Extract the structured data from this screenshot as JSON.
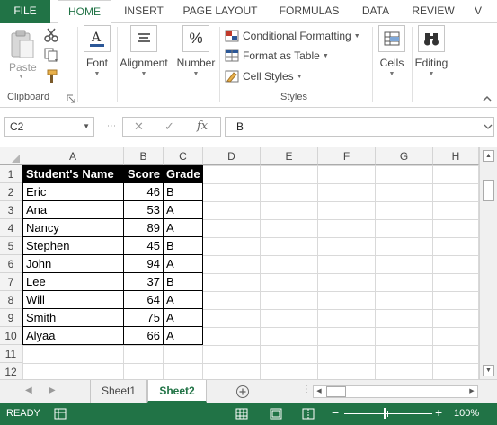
{
  "ribbon_tabs": {
    "file": "FILE",
    "home": "HOME",
    "insert": "INSERT",
    "page_layout": "PAGE LAYOUT",
    "formulas": "FORMULAS",
    "data": "DATA",
    "review": "REVIEW",
    "more": "V"
  },
  "clipboard": {
    "paste_label": "Paste",
    "group_label": "Clipboard"
  },
  "font": {
    "label": "Font",
    "icon": "font-color-icon"
  },
  "alignment": {
    "label": "Alignment",
    "icon": "align-icon"
  },
  "number": {
    "label": "Number",
    "icon": "percent-icon",
    "glyph": "%"
  },
  "styles": {
    "conditional_formatting": "Conditional Formatting",
    "format_as_table": "Format as Table",
    "cell_styles": "Cell Styles",
    "group_label": "Styles"
  },
  "cells": {
    "label": "Cells"
  },
  "editing": {
    "label": "Editing"
  },
  "formula_bar": {
    "name_box": "C2",
    "fx": "fx",
    "value": "B",
    "cancel_glyph": "✕",
    "enter_glyph": "✓"
  },
  "columns": [
    "A",
    "B",
    "C",
    "D",
    "E",
    "F",
    "G",
    "H"
  ],
  "rows": [
    "1",
    "2",
    "3",
    "4",
    "5",
    "6",
    "7",
    "8",
    "9",
    "10",
    "11",
    "12"
  ],
  "table": {
    "headers": [
      "Student's Name",
      "Score",
      "Grade"
    ],
    "rows": [
      [
        "Eric",
        "46",
        "B"
      ],
      [
        "Ana",
        "53",
        "A"
      ],
      [
        "Nancy",
        "89",
        "A"
      ],
      [
        "Stephen",
        "45",
        "B"
      ],
      [
        "John",
        "94",
        "A"
      ],
      [
        "Lee",
        "37",
        "B"
      ],
      [
        "Will",
        "64",
        "A"
      ],
      [
        "Smith",
        "75",
        "A"
      ],
      [
        "Alyaa",
        "66",
        "A"
      ]
    ]
  },
  "sheets": {
    "tab1": "Sheet1",
    "tab2": "Sheet2",
    "active": "Sheet2"
  },
  "status": {
    "text": "READY",
    "zoom": "100%",
    "zoom_level": 1.0
  },
  "colors": {
    "brand_green": "#217346",
    "header_fill": "#000000"
  }
}
